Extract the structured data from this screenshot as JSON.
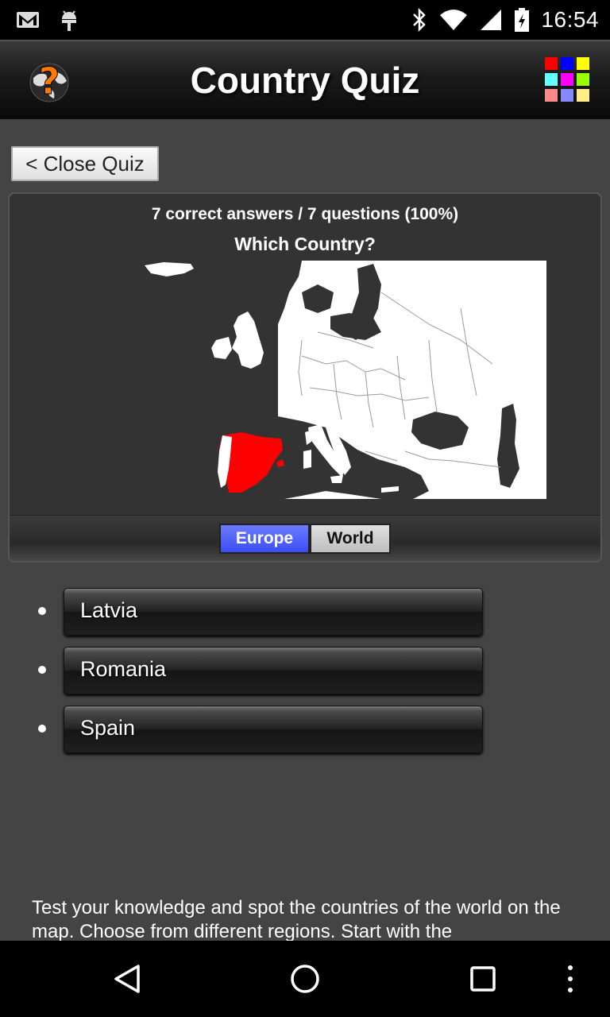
{
  "status_bar": {
    "time": "16:54",
    "icons": [
      "gmail-icon",
      "android-debug-icon",
      "bluetooth-icon",
      "wifi-icon",
      "cell-signal-icon",
      "battery-charging-icon"
    ]
  },
  "app_bar": {
    "title": "Country Quiz",
    "logo_icon": "globe-question-icon",
    "menu_icon": "color-grid-icon",
    "grid_colors": [
      "#ff0000",
      "#0000ff",
      "#ffff00",
      "#66ffff",
      "#ff00ff",
      "#99ff00",
      "#ff8888",
      "#8888ff",
      "#ffee88"
    ]
  },
  "close_button": {
    "label": "< Close Quiz"
  },
  "quiz": {
    "score": "7 correct answers / 7 questions (100%)",
    "question": "Which Country?",
    "highlight_color": "#ff0000",
    "tabs": [
      {
        "label": "Europe",
        "active": true
      },
      {
        "label": "World",
        "active": false
      }
    ]
  },
  "answers": [
    {
      "label": "Latvia"
    },
    {
      "label": "Romania"
    },
    {
      "label": "Spain"
    }
  ],
  "description": "Test your knowledge and spot the countries of the world on the map. Choose from different regions. Start with the",
  "nav_bar": {
    "items": [
      "back-icon",
      "home-icon",
      "recents-icon",
      "overflow-menu-icon"
    ]
  }
}
